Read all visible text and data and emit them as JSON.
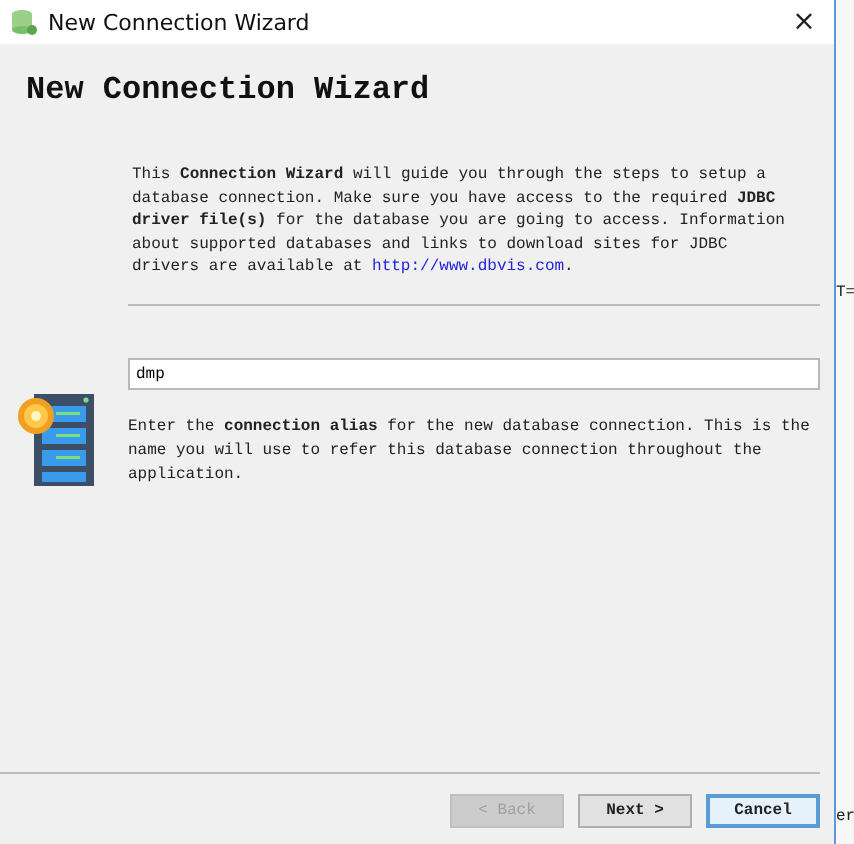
{
  "window": {
    "title": "New Connection Wizard",
    "close": "×"
  },
  "heading": "New Connection Wizard",
  "intro": "This **Connection Wizard** will guide you through the steps to setup a database connection. Make sure you have access to the required **JDBC driver file(s)** for the database you are going to access. Information about supported databases and links to download sites for JDBC drivers are available at",
  "intro_link": "http://www.dbvis.com",
  "intro_end": ".",
  "alias_field": {
    "value": "dmp"
  },
  "alias_help": "Enter the **connection alias** for the new database connection. This is the name you will use to refer this database connection throughout the application.",
  "buttons": [
    {
      "label": "< Back",
      "disabled": true,
      "focused": false
    },
    {
      "label": "Next >",
      "disabled": false,
      "focused": false
    },
    {
      "label": "Cancel",
      "disabled": false,
      "focused": true
    }
  ],
  "background_window": {
    "fragments": [
      "T=",
      "er"
    ]
  }
}
